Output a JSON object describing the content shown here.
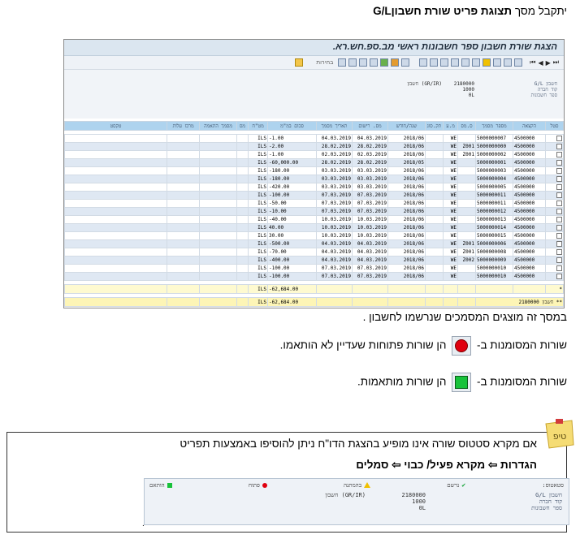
{
  "intro": {
    "prefix": "יתקבל מסך",
    "title": "תצוגת פריט שורת חשבון",
    "title_tail": "G/L"
  },
  "sap": {
    "title": "הצגת שורת חשבון ספר חשבונות ראשי מב.ספ.חש.רא.",
    "toolbar_text": "בחירות",
    "header": {
      "labels": [
        "חשבון G/L",
        "קוד חברה",
        "ספר חשבונות"
      ],
      "values": [
        "2180000",
        "1000",
        "0L"
      ],
      "extra": "(GR/IR) חשבון"
    },
    "columns": [
      "סטל",
      "הקצאה",
      "מספר מסמך",
      "ס.מס",
      "מ.ע",
      "תק.סוג",
      "שנה/חודש",
      "מס. רישום",
      "תאריך מסמך",
      "סכום במ\"מ",
      "מט\"ח",
      "מס",
      "מסמך התאמה",
      "מרכז עלות",
      "טקסט"
    ],
    "rows": [
      [
        "",
        "4500000",
        "5000000007",
        "",
        "WE",
        "",
        "2018/06",
        "04.03.2019",
        "04.03.2019",
        "-1.00",
        "ILS",
        "",
        "",
        "",
        ""
      ],
      [
        "",
        "4500000",
        "5000000000",
        "Z001",
        "WE",
        "",
        "2018/06",
        "28.02.2019",
        "28.02.2019",
        "-2.00",
        "ILS",
        "",
        "",
        "",
        ""
      ],
      [
        "",
        "4500000",
        "5000000002",
        "Z001",
        "WE",
        "",
        "2018/06",
        "02.03.2019",
        "02.03.2019",
        "-1.00",
        "ILS",
        "",
        "",
        "",
        ""
      ],
      [
        "",
        "4500000",
        "5000000001",
        "",
        "WE",
        "",
        "2018/05",
        "28.02.2019",
        "28.02.2019",
        "-60,000.00",
        "ILS",
        "",
        "",
        "",
        ""
      ],
      [
        "",
        "4500000",
        "5000000003",
        "",
        "WE",
        "",
        "2018/06",
        "03.03.2019",
        "03.03.2019",
        "-180.00",
        "ILS",
        "",
        "",
        "",
        ""
      ],
      [
        "",
        "4500000",
        "5000000004",
        "",
        "WE",
        "",
        "2018/06",
        "03.03.2019",
        "03.03.2019",
        "-180.00",
        "ILS",
        "",
        "",
        "",
        ""
      ],
      [
        "",
        "4500000",
        "5000000005",
        "",
        "WE",
        "",
        "2018/06",
        "03.03.2019",
        "03.03.2019",
        "-420.00",
        "ILS",
        "",
        "",
        "",
        ""
      ],
      [
        "",
        "4500000",
        "5000000011",
        "",
        "WE",
        "",
        "2018/06",
        "07.03.2019",
        "07.03.2019",
        "-100.00",
        "ILS",
        "",
        "",
        "",
        ""
      ],
      [
        "",
        "4500000",
        "5000000011",
        "",
        "WE",
        "",
        "2018/06",
        "07.03.2019",
        "07.03.2019",
        "-50.00",
        "ILS",
        "",
        "",
        "",
        ""
      ],
      [
        "",
        "4500000",
        "5000000012",
        "",
        "WE",
        "",
        "2018/06",
        "07.03.2019",
        "07.03.2019",
        "-10.00",
        "ILS",
        "",
        "",
        "",
        ""
      ],
      [
        "",
        "4500000",
        "5000000013",
        "",
        "WE",
        "",
        "2018/06",
        "10.03.2019",
        "10.03.2019",
        "-40.00",
        "ILS",
        "",
        "",
        "",
        ""
      ],
      [
        "",
        "4500000",
        "5000000014",
        "",
        "WE",
        "",
        "2018/06",
        "10.03.2019",
        "10.03.2019",
        "40.00",
        "ILS",
        "",
        "",
        "",
        ""
      ],
      [
        "",
        "4500000",
        "5000000015",
        "",
        "WE",
        "",
        "2018/06",
        "10.03.2019",
        "10.03.2019",
        "30.00",
        "ILS",
        "",
        "",
        "",
        ""
      ],
      [
        "",
        "4500000",
        "5000000006",
        "Z001",
        "WE",
        "",
        "2018/06",
        "04.03.2019",
        "04.03.2019",
        "-500.00",
        "ILS",
        "",
        "",
        "",
        ""
      ],
      [
        "",
        "4500000",
        "5000000008",
        "Z001",
        "WE",
        "",
        "2018/06",
        "04.03.2019",
        "04.03.2019",
        "-70.00",
        "ILS",
        "",
        "",
        "",
        ""
      ],
      [
        "",
        "4500000",
        "5000000009",
        "Z002",
        "WE",
        "",
        "2018/06",
        "04.03.2019",
        "04.03.2019",
        "-400.00",
        "ILS",
        "",
        "",
        "",
        ""
      ],
      [
        "",
        "4500000",
        "5000000010",
        "",
        "WE",
        "",
        "2018/06",
        "07.03.2019",
        "07.03.2019",
        "-100.00",
        "ILS",
        "",
        "",
        "",
        ""
      ],
      [
        "",
        "4500000",
        "5000000010",
        "",
        "WE",
        "",
        "2018/06",
        "07.03.2019",
        "07.03.2019",
        "-100.00",
        "ILS",
        "",
        "",
        "",
        ""
      ]
    ],
    "sum_row": {
      "marker": "*",
      "currency": "ILS",
      "amount": "-62,684.00"
    },
    "total_row": {
      "marker": "**",
      "label": "חשבון",
      "account": "2180000",
      "currency": "ILS",
      "amount": "-62,684.00"
    }
  },
  "desc1": "במסך זה מוצגים המסמכים שנרשמו לחשבון .",
  "desc_open": {
    "before": "שורות המסומנות ב-",
    "after": "הן שורות פתוחות שעדיין לא הותאמו."
  },
  "desc_matched": {
    "before": "שורות המסומנות ב-",
    "after": "הן שורות מותאמות."
  },
  "tip": {
    "note_label": "טיפ",
    "line1": "אם מקרא סטטוס שורה אינו מופיע בהצגת הדו\"ח ניתן להוסיפו באמצעות תפריט",
    "line2": "הגדרות ⇦ מקרא פעיל/ כבוי ⇦ סמלים",
    "legend": [
      "סטאטוס:",
      "נרשם",
      "בהמתנה",
      "פתוח",
      "הותאם"
    ],
    "labels": [
      "חשבון G/L",
      "קוד חברה",
      "ספר חשבונות"
    ],
    "values": [
      "2180000",
      "1000",
      "0L"
    ],
    "extra": "(GR/IR) חשבון",
    "trailing_dot": "."
  },
  "colors": {
    "header_blue": "#aed3ee",
    "row_alt": "#dfe8f3",
    "sum_yellow": "#fefad0",
    "open_red": "#e0000f",
    "matched_green": "#18c23b"
  }
}
